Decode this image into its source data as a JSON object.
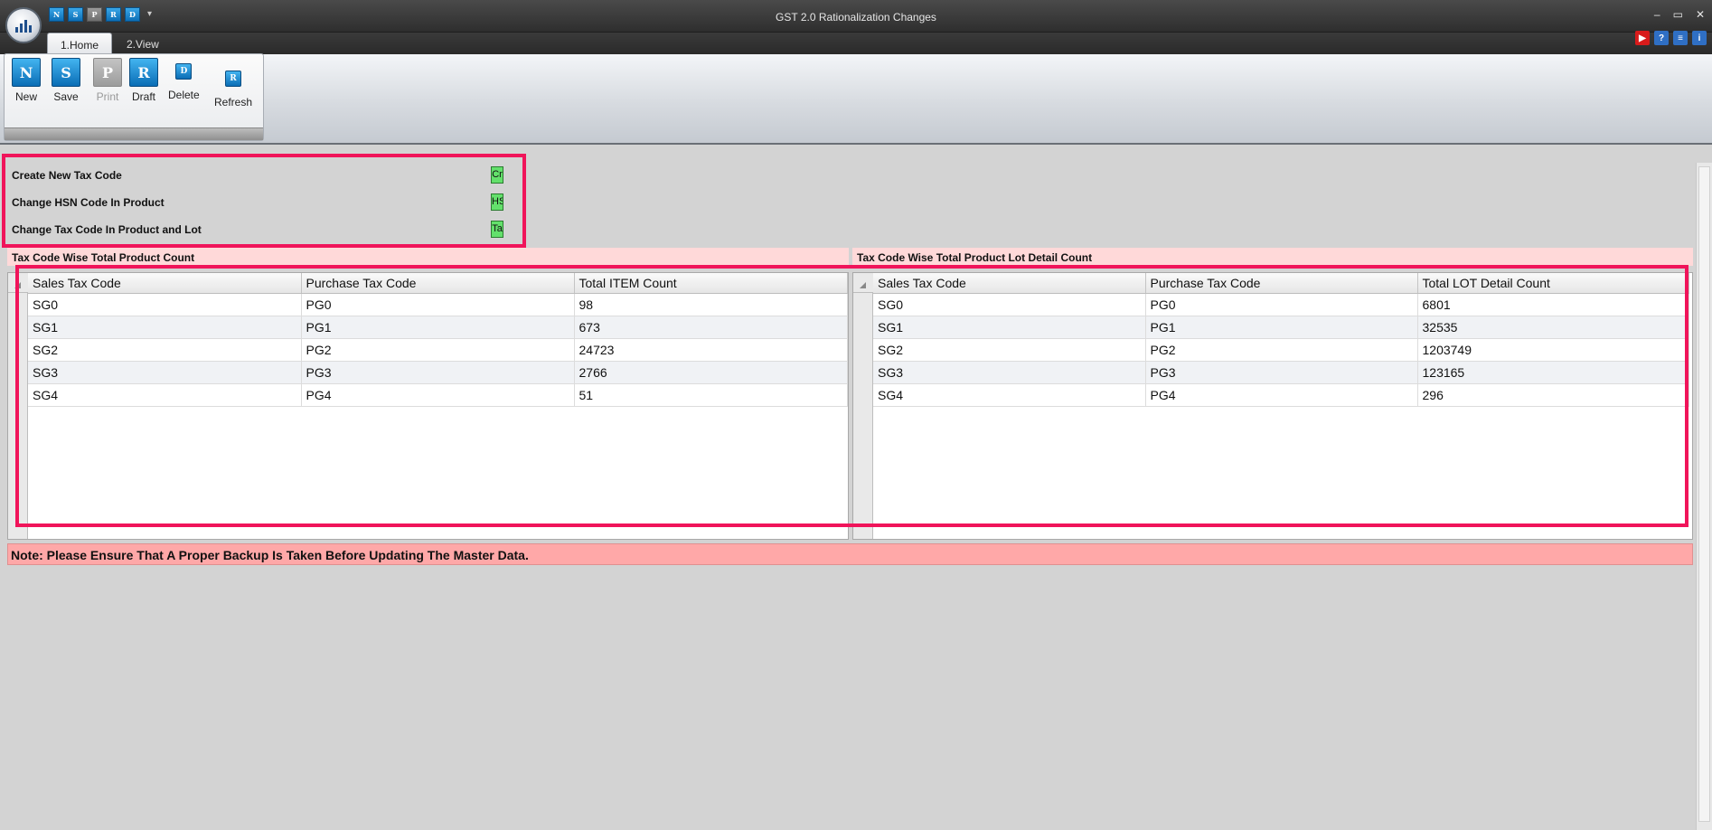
{
  "window": {
    "title": "GST 2.0 Rationalization Changes",
    "controls": [
      "–",
      "▭",
      "✕"
    ]
  },
  "quick_access": [
    {
      "glyph": "N",
      "enabled": true
    },
    {
      "glyph": "S",
      "enabled": true
    },
    {
      "glyph": "P",
      "enabled": false
    },
    {
      "glyph": "R",
      "enabled": true
    },
    {
      "glyph": "D",
      "enabled": true
    }
  ],
  "tabs": [
    {
      "label": "1.Home",
      "active": true
    },
    {
      "label": "2.View",
      "active": false
    }
  ],
  "help_icons": [
    "youtube-icon",
    "help-icon",
    "notes-icon",
    "info-icon"
  ],
  "ribbon": {
    "buttons": [
      {
        "label": "New",
        "glyph": "N",
        "enabled": true
      },
      {
        "label": "Save",
        "glyph": "S",
        "enabled": true
      },
      {
        "label": "Print",
        "glyph": "P",
        "enabled": false
      },
      {
        "label": "Draft",
        "glyph": "R",
        "enabled": true
      },
      {
        "label": "Delete",
        "glyph": "D",
        "enabled": true
      },
      {
        "label": "Refresh",
        "glyph": "R",
        "enabled": true
      }
    ]
  },
  "actions": [
    {
      "label": "Create New Tax Code",
      "button": "Cr"
    },
    {
      "label": "Change HSN Code In Product",
      "button": "HS"
    },
    {
      "label": "Change Tax Code In Product and Lot",
      "button": "Ta"
    }
  ],
  "product_count": {
    "title": "Tax Code Wise Total Product Count",
    "columns": [
      "Sales Tax Code",
      "Purchase Tax Code",
      "Total ITEM Count"
    ],
    "rows": [
      [
        "SG0",
        "PG0",
        "98"
      ],
      [
        "SG1",
        "PG1",
        "673"
      ],
      [
        "SG2",
        "PG2",
        "24723"
      ],
      [
        "SG3",
        "PG3",
        "2766"
      ],
      [
        "SG4",
        "PG4",
        "51"
      ]
    ]
  },
  "lot_count": {
    "title": "Tax Code Wise Total Product Lot Detail Count",
    "columns": [
      "Sales Tax Code",
      "Purchase Tax Code",
      "Total LOT Detail Count"
    ],
    "rows": [
      [
        "SG0",
        "PG0",
        "6801"
      ],
      [
        "SG1",
        "PG1",
        "32535"
      ],
      [
        "SG2",
        "PG2",
        "1203749"
      ],
      [
        "SG3",
        "PG3",
        "123165"
      ],
      [
        "SG4",
        "PG4",
        "296"
      ]
    ]
  },
  "note": "Note: Please Ensure That A Proper Backup Is Taken Before Updating The Master Data."
}
